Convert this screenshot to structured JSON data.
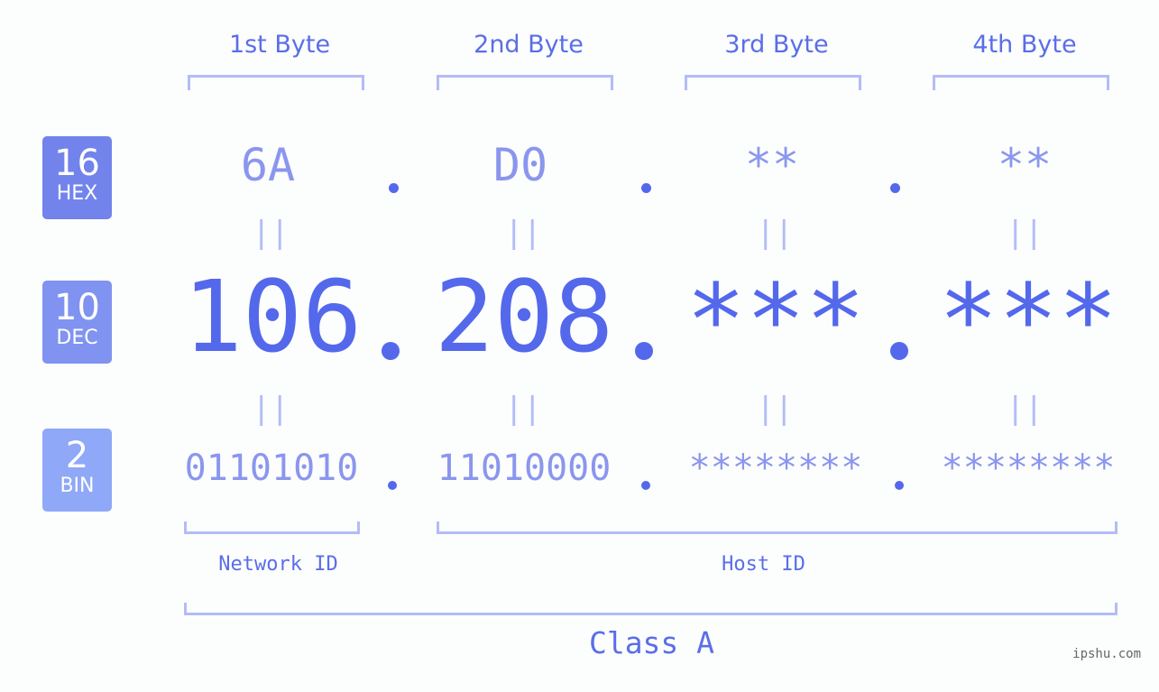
{
  "byte_headers": [
    "1st Byte",
    "2nd Byte",
    "3rd Byte",
    "4th Byte"
  ],
  "badges": {
    "hex": {
      "num": "16",
      "label": "HEX",
      "color": "#7283ec"
    },
    "dec": {
      "num": "10",
      "label": "DEC",
      "color": "#8093f1"
    },
    "bin": {
      "num": "2",
      "label": "BIN",
      "color": "#8fa8f7"
    }
  },
  "hex_values": [
    "6A",
    "D0",
    "**",
    "**"
  ],
  "dec_values": [
    "106",
    "208",
    "***",
    "***"
  ],
  "bin_values": [
    "01101010",
    "11010000",
    "********",
    "********"
  ],
  "equals_glyph": "||",
  "network_id_label": "Network ID",
  "host_id_label": "Host ID",
  "class_label": "Class A",
  "site": "ipshu.com",
  "colors": {
    "primary": "#5468ec",
    "light": "#8a96ee",
    "bracket": "#b3bcf6"
  }
}
